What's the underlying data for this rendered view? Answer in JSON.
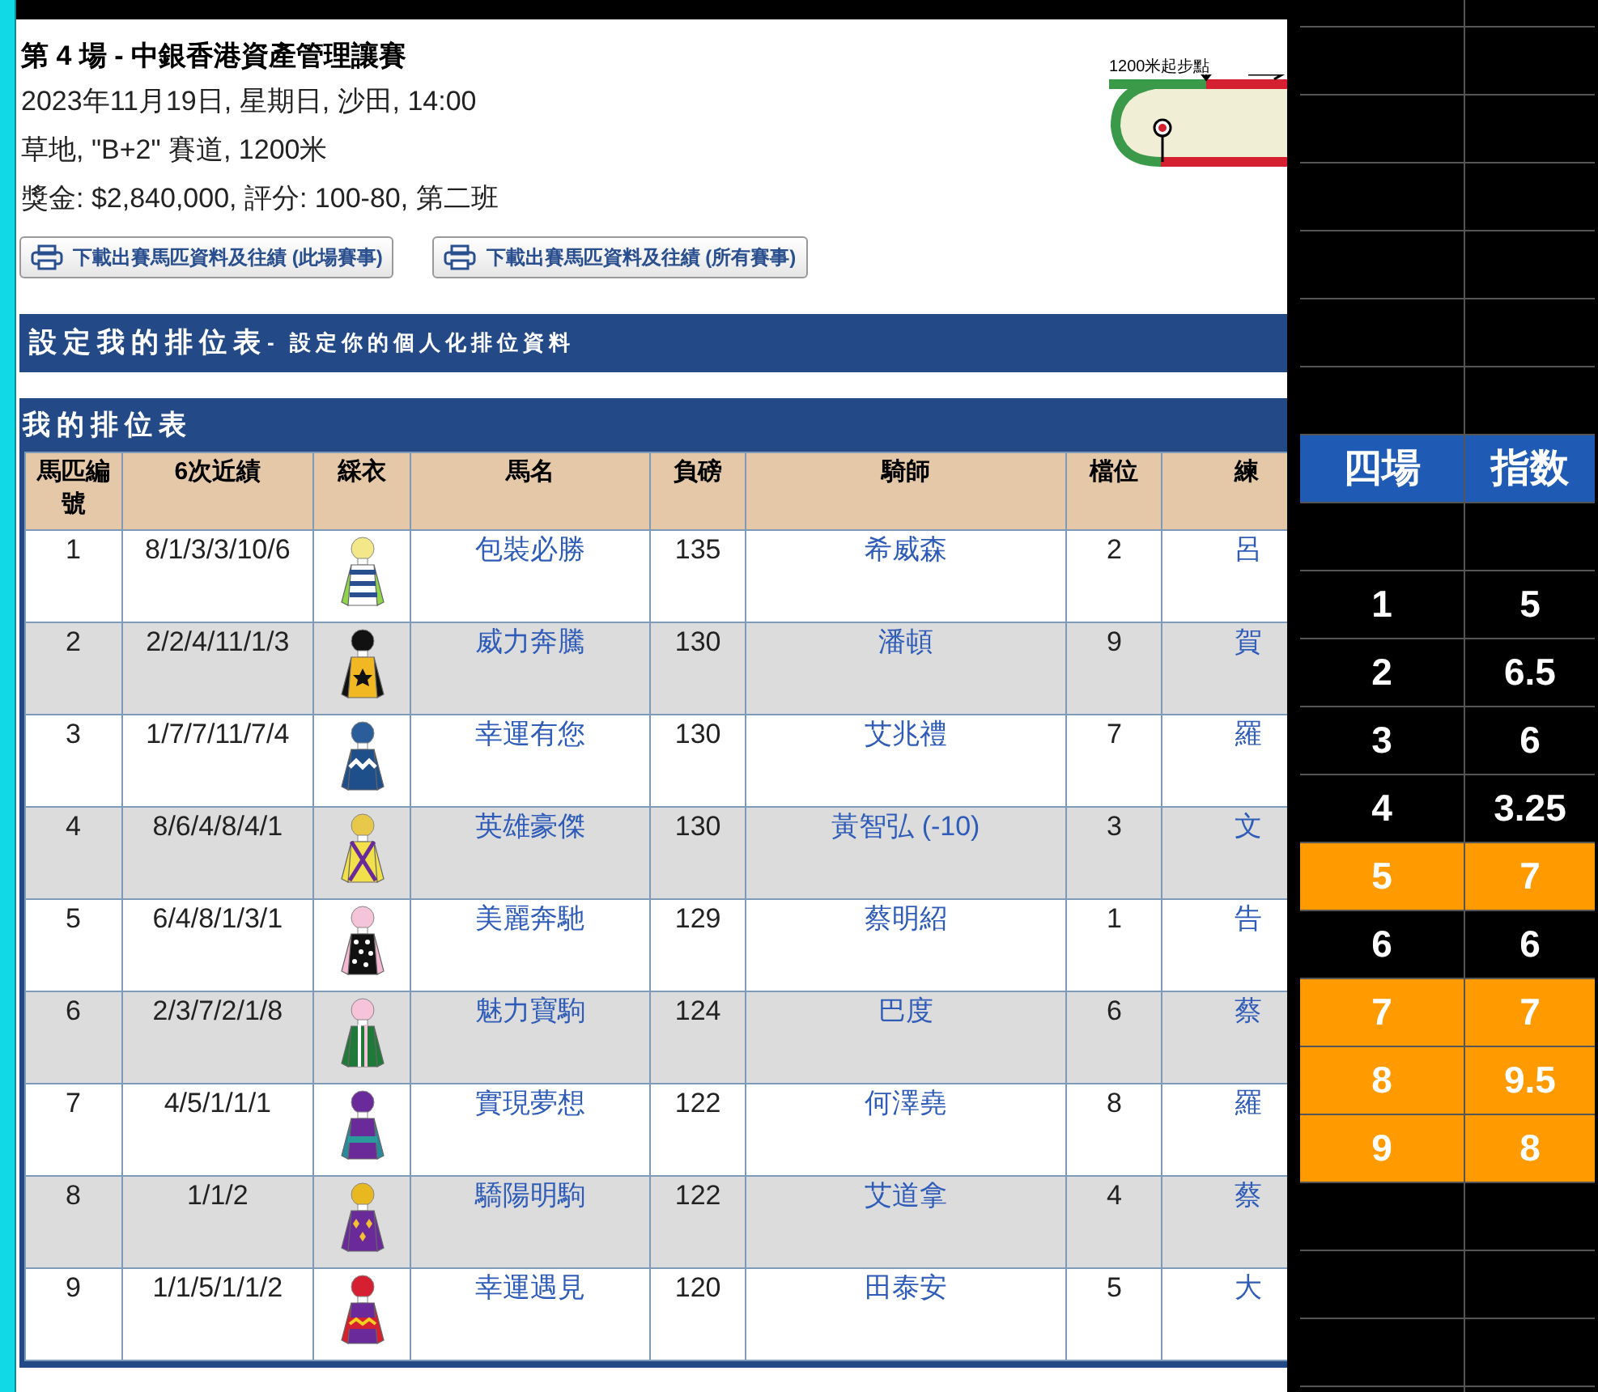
{
  "race": {
    "title": "第 4 場 - 中銀香港資產管理讓賽",
    "lines": [
      "2023年11月19日, 星期日, 沙田, 14:00",
      "草地, \"B+2\" 賽道, 1200米",
      "獎金: $2,840,000, 評分: 100-80, 第二班"
    ],
    "track_label": "1200米起步點",
    "buttons": [
      "下載出賽馬匹資料及往績 (此場賽事)",
      "下載出賽馬匹資料及往績 (所有賽事)"
    ]
  },
  "settings_bar": {
    "title": "設定我的排位表",
    "subtitle": "- 設定你的個人化排位資料"
  },
  "table": {
    "title": "我的排位表",
    "columns": [
      "馬匹編號",
      "6次近績",
      "綵衣",
      "馬名",
      "負磅",
      "騎師",
      "檔位",
      "練"
    ],
    "rows": [
      {
        "no": "1",
        "form": "8/1/3/3/10/6",
        "horse": "包裝必勝",
        "weight": "135",
        "jockey": "希威森",
        "draw": "2",
        "trainer": "呂"
      },
      {
        "no": "2",
        "form": "2/2/4/11/1/3",
        "horse": "威力奔騰",
        "weight": "130",
        "jockey": "潘頓",
        "draw": "9",
        "trainer": "賀"
      },
      {
        "no": "3",
        "form": "1/7/7/11/7/4",
        "horse": "幸運有您",
        "weight": "130",
        "jockey": "艾兆禮",
        "draw": "7",
        "trainer": "羅"
      },
      {
        "no": "4",
        "form": "8/6/4/8/4/1",
        "horse": "英雄豪傑",
        "weight": "130",
        "jockey": "黃智弘 (-10)",
        "draw": "3",
        "trainer": "文"
      },
      {
        "no": "5",
        "form": "6/4/8/1/3/1",
        "horse": "美麗奔馳",
        "weight": "129",
        "jockey": "蔡明紹",
        "draw": "1",
        "trainer": "告"
      },
      {
        "no": "6",
        "form": "2/3/7/2/1/8",
        "horse": "魅力寶駒",
        "weight": "124",
        "jockey": "巴度",
        "draw": "6",
        "trainer": "蔡"
      },
      {
        "no": "7",
        "form": "4/5/1/1/1",
        "horse": "實現夢想",
        "weight": "122",
        "jockey": "何澤堯",
        "draw": "8",
        "trainer": "羅"
      },
      {
        "no": "8",
        "form": "1/1/2",
        "horse": "驕陽明駒",
        "weight": "122",
        "jockey": "艾道拿",
        "draw": "4",
        "trainer": "蔡"
      },
      {
        "no": "9",
        "form": "1/1/5/1/1/2",
        "horse": "幸運遇見",
        "weight": "120",
        "jockey": "田泰安",
        "draw": "5",
        "trainer": "大"
      }
    ]
  },
  "sheet": {
    "columns": [
      "四場",
      "指数"
    ],
    "rows": [
      {
        "race": "1",
        "index": "5",
        "highlighted": false
      },
      {
        "race": "2",
        "index": "6.5",
        "highlighted": false
      },
      {
        "race": "3",
        "index": "6",
        "highlighted": false
      },
      {
        "race": "4",
        "index": "3.25",
        "highlighted": false
      },
      {
        "race": "5",
        "index": "7",
        "highlighted": true
      },
      {
        "race": "6",
        "index": "6",
        "highlighted": false
      },
      {
        "race": "7",
        "index": "7",
        "highlighted": true
      },
      {
        "race": "8",
        "index": "9.5",
        "highlighted": true
      },
      {
        "race": "9",
        "index": "8",
        "highlighted": true
      }
    ]
  }
}
